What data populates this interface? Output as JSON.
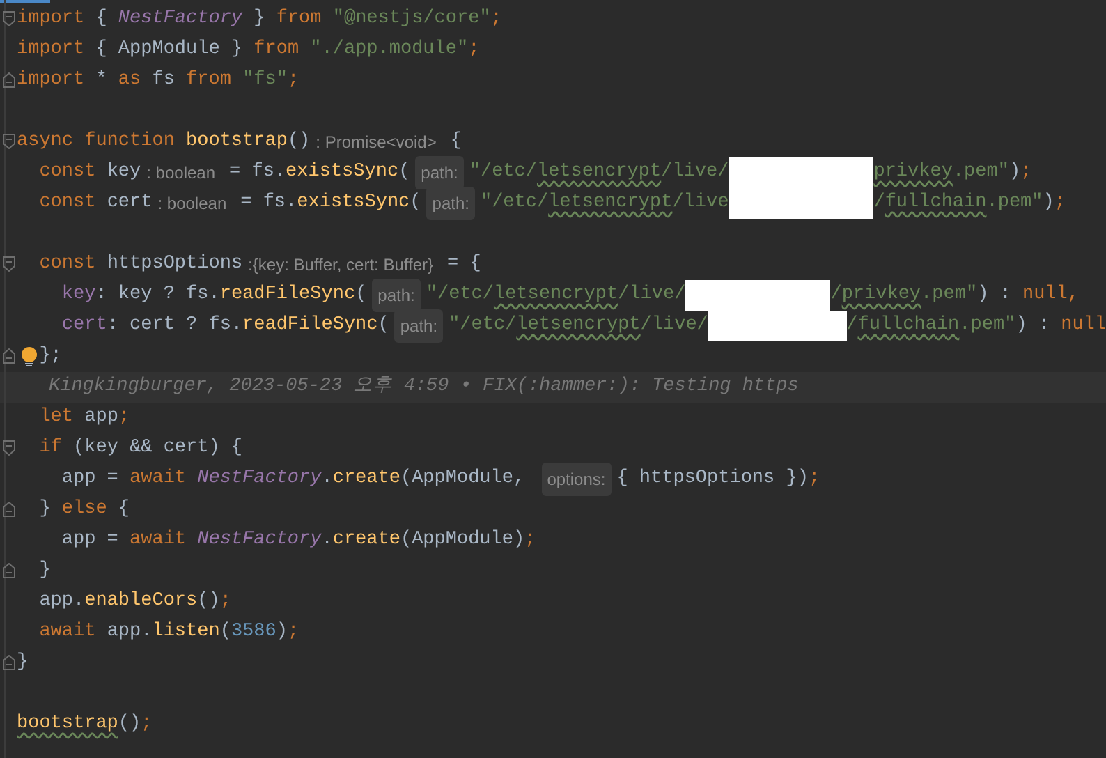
{
  "editor": {
    "lines": [
      {
        "fold_open": true,
        "tokens": [
          {
            "kind": "keyword",
            "text": "import"
          },
          {
            "kind": "plain",
            "text": " { "
          },
          {
            "kind": "class",
            "text": "NestFactory"
          },
          {
            "kind": "plain",
            "text": " } "
          },
          {
            "kind": "keyword",
            "text": "from "
          },
          {
            "kind": "string",
            "text": "\"@nestjs/core\""
          },
          {
            "kind": "keyword",
            "text": ";"
          }
        ]
      },
      {
        "tokens": [
          {
            "kind": "keyword",
            "text": "import"
          },
          {
            "kind": "plain",
            "text": " { AppModule } "
          },
          {
            "kind": "keyword",
            "text": "from "
          },
          {
            "kind": "string",
            "text": "\"./app.module\""
          },
          {
            "kind": "keyword",
            "text": ";"
          }
        ]
      },
      {
        "fold_close": true,
        "tokens": [
          {
            "kind": "keyword",
            "text": "import"
          },
          {
            "kind": "plain",
            "text": " * "
          },
          {
            "kind": "keyword",
            "text": "as"
          },
          {
            "kind": "plain",
            "text": " fs "
          },
          {
            "kind": "keyword",
            "text": "from "
          },
          {
            "kind": "string",
            "text": "\"fs\""
          },
          {
            "kind": "keyword",
            "text": ";"
          }
        ]
      },
      {
        "blank": true
      },
      {
        "fold_open": true,
        "tokens": [
          {
            "kind": "keyword",
            "text": "async function "
          },
          {
            "kind": "function",
            "text": "bootstrap"
          },
          {
            "kind": "plain",
            "text": "()"
          },
          {
            "kind": "hint",
            "text": ": Promise<void>"
          },
          {
            "kind": "plain",
            "text": "{"
          }
        ]
      },
      {
        "tokens": [
          {
            "kind": "keyword",
            "text": "  const"
          },
          {
            "kind": "plain",
            "text": " key"
          },
          {
            "kind": "hint",
            "text": ": boolean"
          },
          {
            "kind": "plain",
            "text": "= fs."
          },
          {
            "kind": "function",
            "text": "existsSync"
          },
          {
            "kind": "plain",
            "text": "("
          },
          {
            "kind": "hint_box",
            "text": "path:"
          },
          {
            "kind": "string",
            "text": "\"/etc/"
          },
          {
            "kind": "string",
            "text": "letsencrypt",
            "typo": true
          },
          {
            "kind": "string",
            "text": "/live/"
          },
          {
            "kind": "redaction"
          },
          {
            "kind": "string",
            "text": "privkey",
            "typo": true
          },
          {
            "kind": "string",
            "text": ".pem\""
          },
          {
            "kind": "plain",
            "text": ")"
          },
          {
            "kind": "keyword",
            "text": ";"
          }
        ]
      },
      {
        "tokens": [
          {
            "kind": "keyword",
            "text": "  const"
          },
          {
            "kind": "plain",
            "text": " cert"
          },
          {
            "kind": "hint",
            "text": ": boolean"
          },
          {
            "kind": "plain",
            "text": "= fs."
          },
          {
            "kind": "function",
            "text": "existsSync"
          },
          {
            "kind": "plain",
            "text": "("
          },
          {
            "kind": "hint_box",
            "text": "path:"
          },
          {
            "kind": "string",
            "text": "\"/etc/"
          },
          {
            "kind": "string",
            "text": "letsencrypt",
            "typo": true
          },
          {
            "kind": "string",
            "text": "/live"
          },
          {
            "kind": "redaction"
          },
          {
            "kind": "string",
            "text": "/"
          },
          {
            "kind": "string",
            "text": "fullchain",
            "typo": true
          },
          {
            "kind": "string",
            "text": ".pem\""
          },
          {
            "kind": "plain",
            "text": ")"
          },
          {
            "kind": "keyword",
            "text": ";"
          }
        ]
      },
      {
        "blank": true
      },
      {
        "fold_open": true,
        "tokens": [
          {
            "kind": "keyword",
            "text": "  const"
          },
          {
            "kind": "plain",
            "text": " httpsOptions"
          },
          {
            "kind": "hint",
            "text": ":{key: Buffer, cert: Buffer}"
          },
          {
            "kind": "plain",
            "text": "= {"
          }
        ]
      },
      {
        "tokens": [
          {
            "kind": "property",
            "text": "    key"
          },
          {
            "kind": "plain",
            "text": ": key ? fs."
          },
          {
            "kind": "function",
            "text": "readFileSync"
          },
          {
            "kind": "plain",
            "text": "("
          },
          {
            "kind": "hint_box",
            "text": "path:"
          },
          {
            "kind": "string",
            "text": "\"/etc/"
          },
          {
            "kind": "string",
            "text": "letsencrypt",
            "typo": true
          },
          {
            "kind": "string",
            "text": "/live/"
          },
          {
            "kind": "redaction"
          },
          {
            "kind": "string",
            "text": "/"
          },
          {
            "kind": "string",
            "text": "privkey",
            "typo": true
          },
          {
            "kind": "string",
            "text": ".pem\""
          },
          {
            "kind": "plain",
            "text": ") : "
          },
          {
            "kind": "keyword",
            "text": "null,"
          }
        ]
      },
      {
        "tokens": [
          {
            "kind": "property",
            "text": "    cert"
          },
          {
            "kind": "plain",
            "text": ": cert ? fs."
          },
          {
            "kind": "function",
            "text": "readFileSync"
          },
          {
            "kind": "plain",
            "text": "("
          },
          {
            "kind": "hint_box",
            "text": "path:"
          },
          {
            "kind": "string",
            "text": "\"/etc/"
          },
          {
            "kind": "string",
            "text": "letsencrypt",
            "typo": true
          },
          {
            "kind": "string",
            "text": "/live/"
          },
          {
            "kind": "redaction"
          },
          {
            "kind": "string",
            "text": "/"
          },
          {
            "kind": "string",
            "text": "fullchain",
            "typo": true
          },
          {
            "kind": "string",
            "text": ".pem\""
          },
          {
            "kind": "plain",
            "text": ") : "
          },
          {
            "kind": "keyword",
            "text": "null"
          }
        ]
      },
      {
        "fold_close": true,
        "bulb": true,
        "tokens": [
          {
            "kind": "plain",
            "text": "  };"
          }
        ]
      },
      {
        "blame": "Kingkingburger, 2023-05-23 오후 4:59 • FIX(:hammer:): Testing https"
      },
      {
        "tokens": [
          {
            "kind": "keyword",
            "text": "  let"
          },
          {
            "kind": "plain",
            "text": " app"
          },
          {
            "kind": "keyword",
            "text": ";"
          }
        ]
      },
      {
        "fold_open": true,
        "tokens": [
          {
            "kind": "keyword",
            "text": "  if"
          },
          {
            "kind": "plain",
            "text": " (key && cert) {"
          }
        ]
      },
      {
        "tokens": [
          {
            "kind": "plain",
            "text": "    app = "
          },
          {
            "kind": "keyword",
            "text": "await "
          },
          {
            "kind": "class",
            "text": "NestFactory"
          },
          {
            "kind": "plain",
            "text": "."
          },
          {
            "kind": "function",
            "text": "create"
          },
          {
            "kind": "plain",
            "text": "(AppModule, "
          },
          {
            "kind": "hint_box",
            "text": "options:"
          },
          {
            "kind": "plain",
            "text": "{ httpsOptions })"
          },
          {
            "kind": "keyword",
            "text": ";"
          }
        ]
      },
      {
        "fold_close": true,
        "tokens": [
          {
            "kind": "plain",
            "text": "  } "
          },
          {
            "kind": "keyword",
            "text": "else"
          },
          {
            "kind": "plain",
            "text": " {"
          }
        ]
      },
      {
        "tokens": [
          {
            "kind": "plain",
            "text": "    app = "
          },
          {
            "kind": "keyword",
            "text": "await "
          },
          {
            "kind": "class",
            "text": "NestFactory"
          },
          {
            "kind": "plain",
            "text": "."
          },
          {
            "kind": "function",
            "text": "create"
          },
          {
            "kind": "plain",
            "text": "(AppModule)"
          },
          {
            "kind": "keyword",
            "text": ";"
          }
        ]
      },
      {
        "fold_close": true,
        "tokens": [
          {
            "kind": "plain",
            "text": "  }"
          }
        ]
      },
      {
        "tokens": [
          {
            "kind": "plain",
            "text": "  app."
          },
          {
            "kind": "function",
            "text": "enableCors"
          },
          {
            "kind": "plain",
            "text": "()"
          },
          {
            "kind": "keyword",
            "text": ";"
          }
        ]
      },
      {
        "tokens": [
          {
            "kind": "keyword",
            "text": "  await"
          },
          {
            "kind": "plain",
            "text": " app."
          },
          {
            "kind": "function",
            "text": "listen"
          },
          {
            "kind": "plain",
            "text": "("
          },
          {
            "kind": "number",
            "text": "3586"
          },
          {
            "kind": "plain",
            "text": ")"
          },
          {
            "kind": "keyword",
            "text": ";"
          }
        ]
      },
      {
        "fold_close": true,
        "tokens": [
          {
            "kind": "plain",
            "text": "}"
          }
        ]
      },
      {
        "blank": true
      },
      {
        "tokens": [
          {
            "kind": "function",
            "text": "bootstrap",
            "typo": true
          },
          {
            "kind": "plain",
            "text": "()"
          },
          {
            "kind": "keyword",
            "text": ";"
          }
        ]
      }
    ]
  }
}
